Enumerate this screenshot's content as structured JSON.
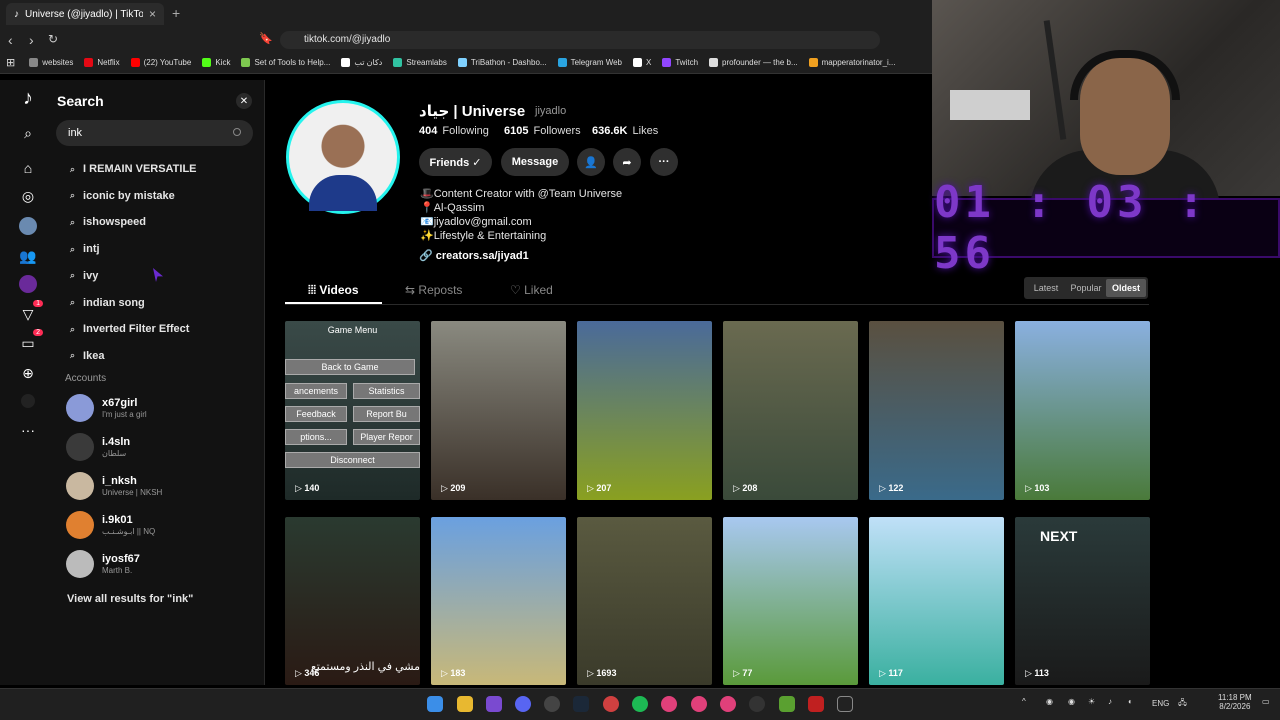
{
  "browser": {
    "tab_title": "Universe (@jiyadlo) | TikTok | جياد",
    "url": "tiktok.com/@jiyadlo",
    "bookmarks": [
      {
        "label": "websites",
        "color": "#888888"
      },
      {
        "label": "Netflix",
        "color": "#e50914"
      },
      {
        "label": "(22) YouTube",
        "color": "#ff0000"
      },
      {
        "label": "Kick",
        "color": "#53fc18"
      },
      {
        "label": "Set of Tools to Help...",
        "color": "#7ec850"
      },
      {
        "label": "دكان تب",
        "color": "#ffffff"
      },
      {
        "label": "Streamlabs",
        "color": "#31c3a2"
      },
      {
        "label": "TriBathon - Dashbo...",
        "color": "#7fd1ff"
      },
      {
        "label": "Telegram Web",
        "color": "#2aa4e0"
      },
      {
        "label": "X",
        "color": "#ffffff"
      },
      {
        "label": "Twitch",
        "color": "#9146ff"
      },
      {
        "label": "profounder — the b...",
        "color": "#dddddd"
      },
      {
        "label": "mapperatorinator_i...",
        "color": "#f0a020"
      }
    ]
  },
  "timer": "01 : 03 : 56",
  "search": {
    "title": "Search",
    "query": "ink",
    "suggestions": [
      "I REMAIN VERSATILE",
      "iconic by mistake",
      "ishowspeed",
      "intj",
      "ivy",
      "indian song",
      "Inverted Filter Effect",
      "Ikea"
    ],
    "accounts_label": "Accounts",
    "accounts": [
      {
        "name": "x67girl",
        "sub": "I'm just a girl",
        "color": "#8a9ad8"
      },
      {
        "name": "i.4sln",
        "sub": "سلطان",
        "color": "#3a3a3a"
      },
      {
        "name": "i_nksh",
        "sub": "Universe | NKSH",
        "color": "#c9b8a0"
      },
      {
        "name": "i.9k01",
        "sub": "ابـوشـنـب || NQ",
        "color": "#e08030"
      },
      {
        "name": "iyosf67",
        "sub": "Marth B.",
        "color": "#bbbbbb"
      }
    ],
    "view_all": "View all results for \"ink\""
  },
  "sidebar": {
    "badges": {
      "activity": "1",
      "messages": "2"
    }
  },
  "profile": {
    "name": "جياد | Universe",
    "handle": "jiyadlo",
    "following_count": "404",
    "following_label": "Following",
    "followers_count": "6105",
    "followers_label": "Followers",
    "likes_count": "636.6K",
    "likes_label": "Likes",
    "friends_btn": "Friends ✓",
    "message_btn": "Message",
    "bio": [
      "🎩Content Creator with @Team Universe",
      "📍Al-Qassim",
      "📧jiyadlov@gmail.com",
      "✨Lifestyle & Entertaining"
    ],
    "link": "creators.sa/jiyad1"
  },
  "tabs": {
    "videos": "Videos",
    "reposts": "Reposts",
    "liked": "Liked"
  },
  "sort": {
    "latest": "Latest",
    "popular": "Popular",
    "oldest": "Oldest"
  },
  "game_menu": {
    "title": "Game Menu",
    "back": "Back to Game",
    "adv": "ancements",
    "stats": "Statistics",
    "feedback": "Feedback",
    "report": "Report Bu",
    "options": "ptions...",
    "player_report": "Player Repor",
    "disconnect": "Disconnect"
  },
  "videos": [
    {
      "views": "140",
      "colors": [
        "#3a4a48",
        "#1e2a28"
      ]
    },
    {
      "views": "209",
      "colors": [
        "#8a8a80",
        "#3a3028"
      ]
    },
    {
      "views": "207",
      "colors": [
        "#4a6a9a",
        "#8aa020"
      ]
    },
    {
      "views": "208",
      "colors": [
        "#6a6a50",
        "#3a4a3a"
      ]
    },
    {
      "views": "122",
      "colors": [
        "#5a5040",
        "#3a6a8a"
      ]
    },
    {
      "views": "103",
      "colors": [
        "#8ab0e0",
        "#4a7a3a"
      ]
    },
    {
      "views": "346",
      "colors": [
        "#2a3a30",
        "#2a1a14"
      ]
    },
    {
      "views": "183",
      "colors": [
        "#6aa0e0",
        "#c8b878"
      ]
    },
    {
      "views": "1693",
      "colors": [
        "#5a5a40",
        "#3a3a2a"
      ]
    },
    {
      "views": "77",
      "colors": [
        "#a8c8f0",
        "#5a9a3a"
      ]
    },
    {
      "views": "117",
      "colors": [
        "#c0e0f8",
        "#3ab0a0"
      ]
    },
    {
      "views": "113",
      "colors": [
        "#2a3a3a",
        "#1a1a1a"
      ]
    }
  ],
  "video_overlays": {
    "arabic_caption": "مشي في النذر ومستمتع",
    "next_label": "NEXT"
  },
  "tray": {
    "lang": "ENG",
    "time": "11:18 PM",
    "date": "8/2/2026"
  }
}
